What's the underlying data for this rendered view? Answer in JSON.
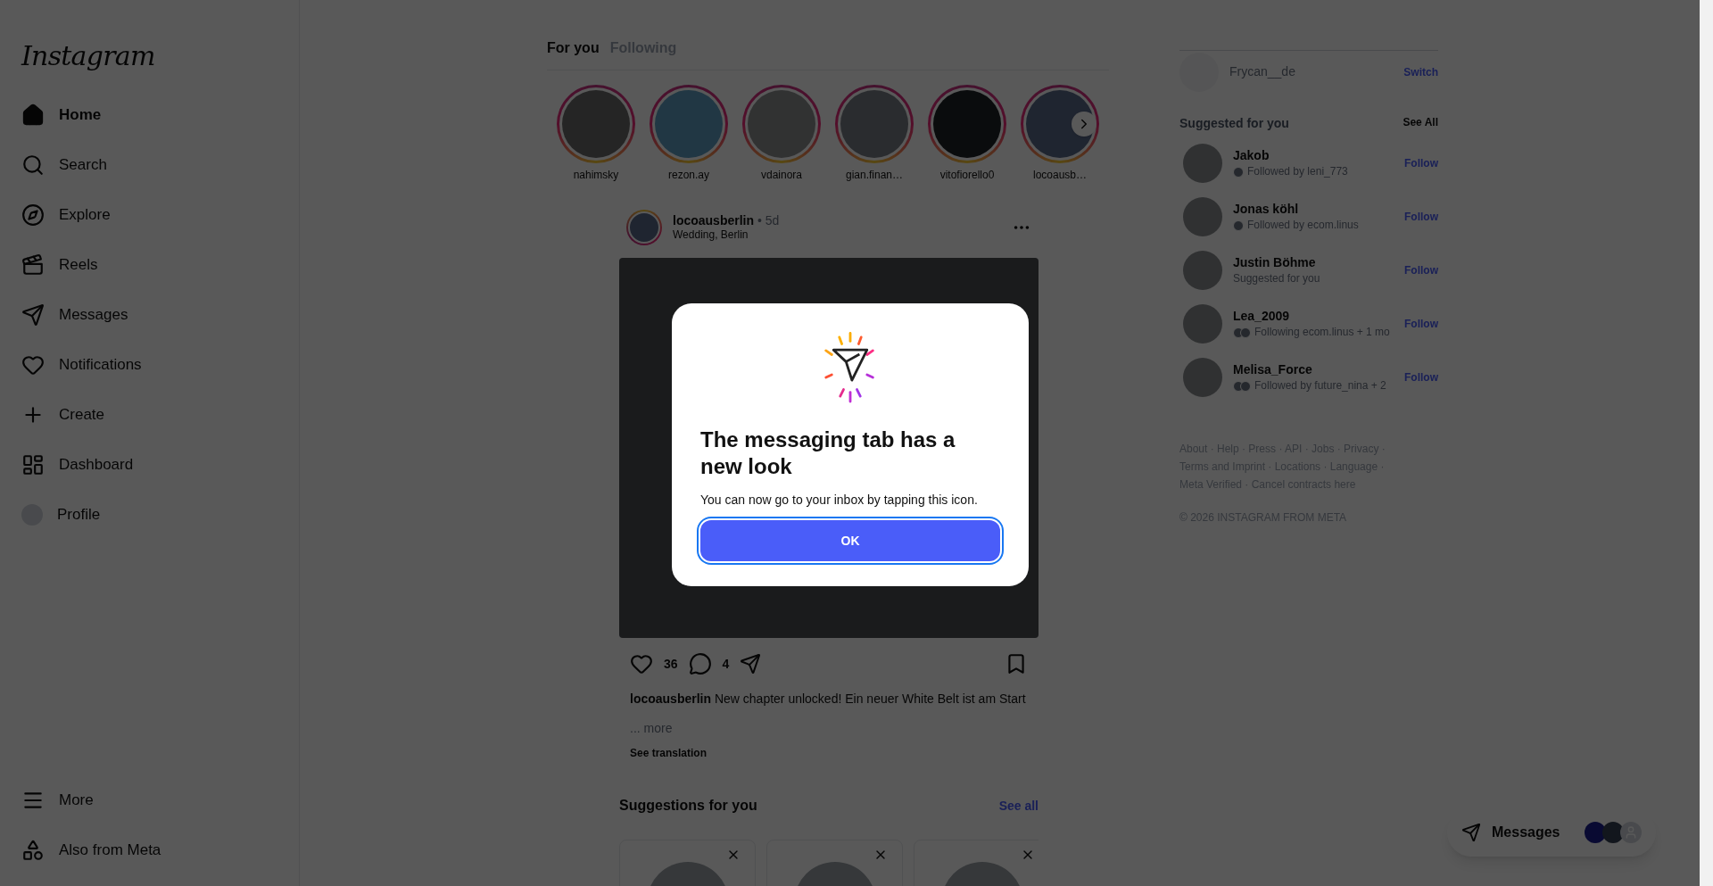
{
  "sidebar": {
    "logo": "Instagram",
    "items": [
      {
        "label": "Home",
        "selected": true
      },
      {
        "label": "Search",
        "selected": false
      },
      {
        "label": "Explore",
        "selected": false
      },
      {
        "label": "Reels",
        "selected": false
      },
      {
        "label": "Messages",
        "selected": false
      },
      {
        "label": "Notifications",
        "selected": false
      },
      {
        "label": "Create",
        "selected": false
      },
      {
        "label": "Dashboard",
        "selected": false
      },
      {
        "label": "Profile",
        "selected": false
      }
    ],
    "bottom_items": [
      {
        "label": "More"
      },
      {
        "label": "Also from Meta"
      }
    ]
  },
  "feed_tabs": [
    {
      "label": "For you",
      "selected": true
    },
    {
      "label": "Following",
      "selected": false
    }
  ],
  "stories": [
    "nahimsky",
    "rezon.ay",
    "vdainora",
    "gian.finan…",
    "vitofiorello0",
    "locoausb…"
  ],
  "post": {
    "username": "locoausberlin",
    "time": "• 5d",
    "location": "Wedding, Berlin",
    "likes": "36",
    "comments": "4",
    "caption_user": "locoausberlin",
    "caption": "New chapter unlocked! Ein neuer White Belt ist am Start",
    "more": "... more",
    "translation": "See translation"
  },
  "suggestions": {
    "title": "Suggestions for you",
    "see_all": "See all"
  },
  "account": {
    "name": "Frycan__de",
    "action": "Switch"
  },
  "suggested": {
    "title": "Suggested for you",
    "see_all": "See All",
    "people": [
      {
        "name": "Jakob",
        "subtitle": "Followed by leni_773",
        "action": "Follow"
      },
      {
        "name": "Jonas köhl",
        "subtitle": "Followed by ecom.linus",
        "action": "Follow"
      },
      {
        "name": "Justin Böhme",
        "subtitle": "Suggested for you",
        "action": "Follow"
      },
      {
        "name": "Lea_2009",
        "subtitle": "Following ecom.linus + 1 mo",
        "action": "Follow"
      },
      {
        "name": "Melisa_Force",
        "subtitle": "Followed by future_nina + 2",
        "action": "Follow"
      }
    ]
  },
  "footer": "About · Help · Press · API · Jobs · Privacy · Terms and Imprint · Locations · Language · Meta Verified · Cancel contracts here",
  "copyright": "© 2026 INSTAGRAM FROM META",
  "messages_pill": {
    "label": "Messages"
  },
  "dialog": {
    "title": "The messaging tab has a new look",
    "body": "You can now go to your inbox by tapping this icon.",
    "button": "OK"
  }
}
